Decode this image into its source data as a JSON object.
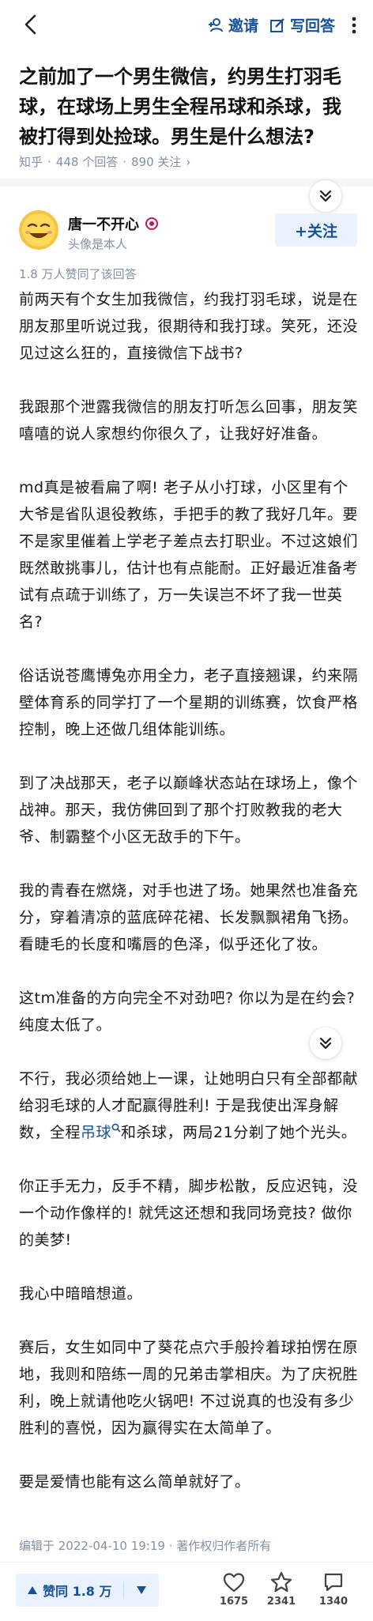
{
  "header": {
    "invite_label": "邀请",
    "write_answer_label": "写回答"
  },
  "question": {
    "title": "之前加了一个男生微信，约男生打羽毛球，在球场上男生全程吊球和杀球，我被打得到处捡球。男生是什么想法?",
    "source": "知乎",
    "answers_count": "448 个回答",
    "followers_count": "890 关注",
    "sep": "·",
    "chevron": "›"
  },
  "author": {
    "name": "唐一不开心",
    "subtitle": "头像是本人",
    "follow_label": "+关注"
  },
  "answer": {
    "vote_summary": "1.8 万人赞同了该回答",
    "paragraphs": [
      "前两天有个女生加我微信，约我打羽毛球，说是在朋友那里听说过我，很期待和我打球。笑死，还没见过这么狂的，直接微信下战书?",
      "我跟那个泄露我微信的朋友打听怎么回事，朋友笑嘻嘻的说人家想约你很久了，让我好好准备。",
      "md真是被看扁了啊! 老子从小打球，小区里有个大爷是省队退役教练，手把手的教了我好几年。要不是家里催着上学老子差点去打职业。不过这娘们既然敢挑事儿，估计也有点能耐。正好最近准备考试有点疏于训练了，万一失误岂不坏了我一世英名?",
      "俗话说苍鹰博兔亦用全力，老子直接翘课，约来隔壁体育系的同学打了一个星期的训练赛，饮食严格控制，晚上还做几组体能训练。",
      "到了决战那天，老子以巅峰状态站在球场上，像个战神。那天，我仿佛回到了那个打败教我的老大爷、制霸整个小区无敌手的下午。",
      "我的青春在燃烧，对手也进了场。她果然也准备充分，穿着清凉的蓝底碎花裙、长发飘飘裙角飞扬。看睫毛的长度和嘴唇的色泽，似乎还化了妆。",
      "这tm准备的方向完全不对劲吧? 你以为是在约会? 纯度太低了。",
      "你正手无力，反手不精，脚步松散，反应迟钝，没一个动作像样的! 就凭这还想和我同场竞技? 做你的美梦!",
      "我心中暗暗想道。",
      "赛后，女生如同中了葵花点穴手般拎着球拍愣在原地，我则和陪练一周的兄弟击掌相庆。为了庆祝胜利，晚上就请他吃火锅吧! 不过说真的也没有多少胜利的喜悦，因为赢得实在太简单了。",
      "要是爱情也能有这么简单就好了。"
    ],
    "lesson_paragraph": {
      "before": "不行，我必须给她上一课，让她明白只有全部都献给羽毛球的人才配赢得胜利! 于是我使出浑身解数，全程",
      "keyword": "吊球",
      "after": "和杀球，两局21分剃了她个光头。"
    },
    "footer_meta": "编辑于 2022-04-10 19:19 · 著作权归作者所有"
  },
  "bottom_bar": {
    "vote_label": "赞同 1.8 万",
    "like_count": "1675",
    "star_count": "2341",
    "comment_count": "1340"
  },
  "colors": {
    "accent": "#175199",
    "accent_bg": "#eaf2ff",
    "meta_gray": "#8590a6"
  }
}
